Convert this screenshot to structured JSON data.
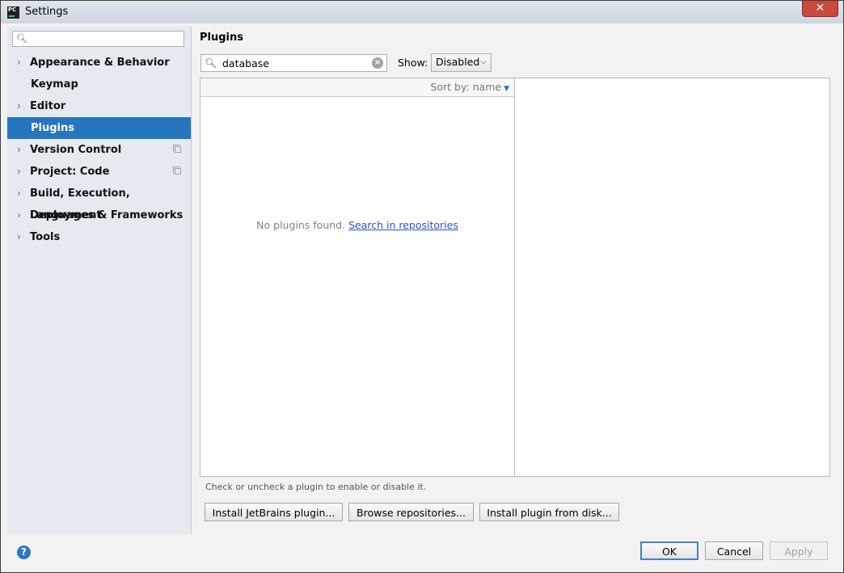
{
  "window": {
    "title": "Settings",
    "close_glyph": "✕",
    "app_icon": "pc-icon"
  },
  "sidebar": {
    "search_placeholder": "",
    "items": [
      {
        "label": "Appearance & Behavior",
        "expandable": true,
        "selected": false,
        "project_level": false
      },
      {
        "label": "Keymap",
        "expandable": false,
        "selected": false,
        "project_level": false
      },
      {
        "label": "Editor",
        "expandable": true,
        "selected": false,
        "project_level": false
      },
      {
        "label": "Plugins",
        "expandable": false,
        "selected": true,
        "project_level": false
      },
      {
        "label": "Version Control",
        "expandable": true,
        "selected": false,
        "project_level": true
      },
      {
        "label": "Project: Code",
        "expandable": true,
        "selected": false,
        "project_level": true
      },
      {
        "label": "Build, Execution, Deployment",
        "expandable": true,
        "selected": false,
        "project_level": false
      },
      {
        "label": "Languages & Frameworks",
        "expandable": true,
        "selected": false,
        "project_level": false
      },
      {
        "label": "Tools",
        "expandable": true,
        "selected": false,
        "project_level": false
      }
    ]
  },
  "main": {
    "title": "Plugins",
    "search_value": "database",
    "show_label": "Show:",
    "show_value": "Disabled",
    "sort_label": "Sort by: name",
    "empty_text": "No plugins found.",
    "empty_link": "Search in repositories",
    "hint": "Check or uncheck a plugin to enable or disable it.",
    "buttons": {
      "install_jetbrains": "Install JetBrains plugin...",
      "browse_repos": "Browse repositories...",
      "install_disk": "Install plugin from disk..."
    }
  },
  "footer": {
    "ok": "OK",
    "cancel": "Cancel",
    "apply": "Apply",
    "help": "?"
  },
  "colors": {
    "selection": "#2675bf",
    "link": "#2a4fd8",
    "sidebar_bg": "#e4eaf0"
  }
}
